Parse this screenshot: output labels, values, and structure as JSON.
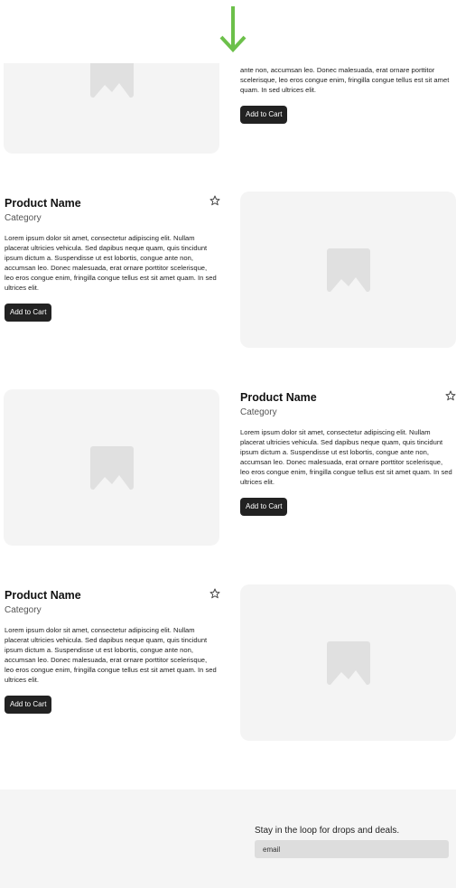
{
  "scroll_indicator": {
    "icon": "arrow-down-icon",
    "color": "#6cc04a"
  },
  "products": [
    {
      "description": "Lorem ipsum dolor sit amet, consectetur adipiscing elit. Nullam placerat ultricies vehicula. Sed dapibus neque quam, quis tincidunt ipsum dictum a. Suspendisse ut est lobortis, congue ante non, accumsan leo. Donec malesuada, erat ornare porttitor scelerisque, leo eros congue enim, fringilla congue tellus est sit amet quam. In sed ultrices elit.",
      "visible_description_tail": "ante non, accumsan leo. Donec malesuada, erat ornare porttitor scelerisque, leo eros congue enim, fringilla congue tellus est sit amet quam. In sed ultrices elit.",
      "button": "Add to Cart"
    },
    {
      "name": "Product Name",
      "category": "Category",
      "description": "Lorem ipsum dolor sit amet, consectetur adipiscing elit. Nullam placerat ultricies vehicula. Sed dapibus neque quam, quis tincidunt ipsum dictum a. Suspendisse ut est lobortis, congue ante non, accumsan leo. Donec malesuada, erat ornare porttitor scelerisque, leo eros congue enim, fringilla congue tellus est sit amet quam. In sed ultrices elit.",
      "button": "Add to Cart"
    },
    {
      "name": "Product Name",
      "category": "Category",
      "description": "Lorem ipsum dolor sit amet, consectetur adipiscing elit. Nullam placerat ultricies vehicula. Sed dapibus neque quam, quis tincidunt ipsum dictum a. Suspendisse ut est lobortis, congue ante non, accumsan leo. Donec malesuada, erat ornare porttitor scelerisque, leo eros congue enim, fringilla congue tellus est sit amet quam. In sed ultrices elit.",
      "button": "Add to Cart"
    },
    {
      "name": "Product Name",
      "category": "Category",
      "description": "Lorem ipsum dolor sit amet, consectetur adipiscing elit. Nullam placerat ultricies vehicula. Sed dapibus neque quam, quis tincidunt ipsum dictum a. Suspendisse ut est lobortis, congue ante non, accumsan leo. Donec malesuada, erat ornare porttitor scelerisque, leo eros congue enim, fringilla congue tellus est sit amet quam. In sed ultrices elit.",
      "button": "Add to Cart"
    }
  ],
  "footer": {
    "newsletter_text": "Stay in the loop for drops and deals.",
    "email_placeholder": "email"
  }
}
